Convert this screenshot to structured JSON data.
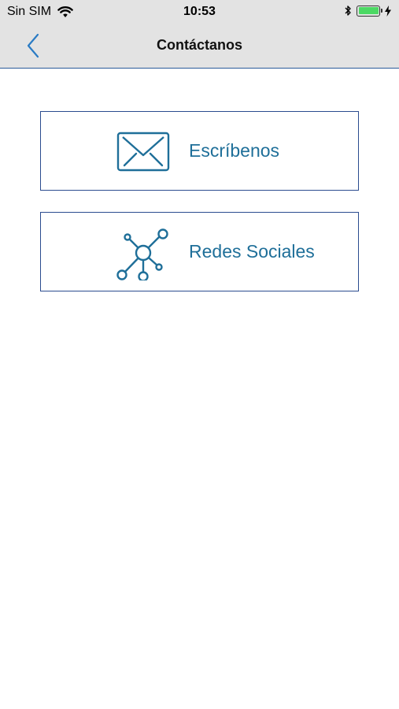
{
  "status_bar": {
    "carrier": "Sin SIM",
    "time": "10:53",
    "icons": [
      "wifi-icon",
      "bluetooth-icon",
      "battery-icon",
      "charging-icon"
    ],
    "battery_level": 1.0
  },
  "nav": {
    "title": "Contáctanos",
    "back_icon": "chevron-left-icon"
  },
  "options": [
    {
      "label": "Escríbenos",
      "icon": "envelope-icon"
    },
    {
      "label": "Redes Sociales",
      "icon": "network-icon"
    }
  ],
  "colors": {
    "bars_background": "#e3e3e3",
    "accent_blue": "#1f6f99",
    "card_border": "#2b4c8f",
    "back_chevron": "#2a7bc4",
    "battery_green": "#4cd964"
  }
}
